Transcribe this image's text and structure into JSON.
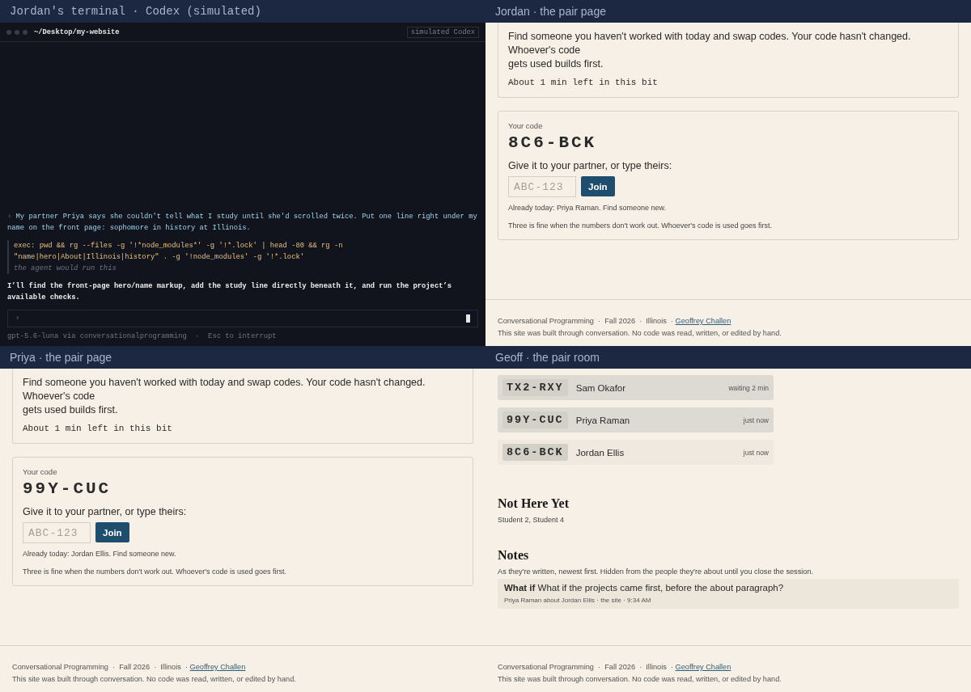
{
  "panes": [
    {
      "kind": "terminal",
      "title": "Jordan's terminal · Codex (simulated)",
      "path": "~/Desktop/my-website",
      "badge": "simulated Codex",
      "prompt_marker": "›",
      "prompt": "My partner Priya says she couldn't tell what I study until she'd scrolled twice. Put one line right under my name on the front page: sophomore in history at Illinois.",
      "exec": {
        "command": "exec: pwd && rg --files -g '!*node_modules*' -g '!*.lock' | head -80 && rg -n \"name|hero|About|Illinois|history\" . -g '!node_modules' -g '!*.lock'",
        "note": "the agent would run this"
      },
      "reply": "I’ll find the front-page hero/name markup, add the study line directly beneath it, and run the project’s available checks.",
      "input_marker": "›",
      "status": "gpt-5.6-luna via conversationalprogramming  ·  Esc to interrupt"
    },
    {
      "kind": "pair_page",
      "title": "Jordan · the pair page",
      "instructions": "Find someone you haven't worked with today and swap codes. Your code hasn't changed. Whoever's code\ngets used builds first.",
      "time_left": "About 1 min left in this bit",
      "code_label": "Your code",
      "code": "8C6-BCK",
      "give_prompt": "Give it to your partner, or type theirs:",
      "code_field": {
        "placeholder": "ABC-123"
      },
      "join_button": "Join",
      "already": "Already today: Priya Raman. Find someone new.",
      "three_note": "Three is fine when the numbers don't work out. Whoever's code is used goes first.",
      "footer": {
        "line": "Conversational Programming  ·  Fall 2026  ·  Illinois  · ",
        "link": "Geoffrey Challen",
        "note": "This site was built through conversation. No code was read, written, or edited by hand."
      }
    },
    {
      "kind": "pair_page",
      "title": "Priya · the pair page",
      "instructions": "Find someone you haven't worked with today and swap codes. Your code hasn't changed. Whoever's code\ngets used builds first.",
      "time_left": "About 1 min left in this bit",
      "code_label": "Your code",
      "code": "99Y-CUC",
      "give_prompt": "Give it to your partner, or type theirs:",
      "code_field": {
        "placeholder": "ABC-123"
      },
      "join_button": "Join",
      "already": "Already today: Jordan Ellis. Find someone new.",
      "three_note": "Three is fine when the numbers don't work out. Whoever's code is used goes first.",
      "footer": {
        "line": "Conversational Programming  ·  Fall 2026  ·  Illinois  · ",
        "link": "Geoffrey Challen",
        "note": "This site was built through conversation. No code was read, written, or edited by hand."
      }
    },
    {
      "kind": "pair_room",
      "title": "Geoff · the pair room",
      "students": [
        {
          "code": "TX2-RXY",
          "name": "Sam Okafor",
          "waiting": "waiting 2 min",
          "active": true
        },
        {
          "code": "99Y-CUC",
          "name": "Priya Raman",
          "waiting": "just now",
          "active": true
        },
        {
          "code": "8C6-BCK",
          "name": "Jordan Ellis",
          "waiting": "just now",
          "active": false
        }
      ],
      "absent_heading": "Not Here Yet",
      "absent": "Student 2, Student 4",
      "notes_heading": "Notes",
      "notes_desc": "As they're written, newest first. Hidden from the people they're about until you close the session.",
      "notes": [
        {
          "text": "**What if** What if the projects came first, before the about paragraph?",
          "meta": "Priya Raman about Jordan Ellis · the site · 9:34 AM"
        }
      ],
      "footer": {
        "line": "Conversational Programming  ·  Fall 2026  ·  Illinois  · ",
        "link": "Geoffrey Challen",
        "note": "This site was built through conversation. No code was read, written, or edited by hand."
      }
    }
  ]
}
